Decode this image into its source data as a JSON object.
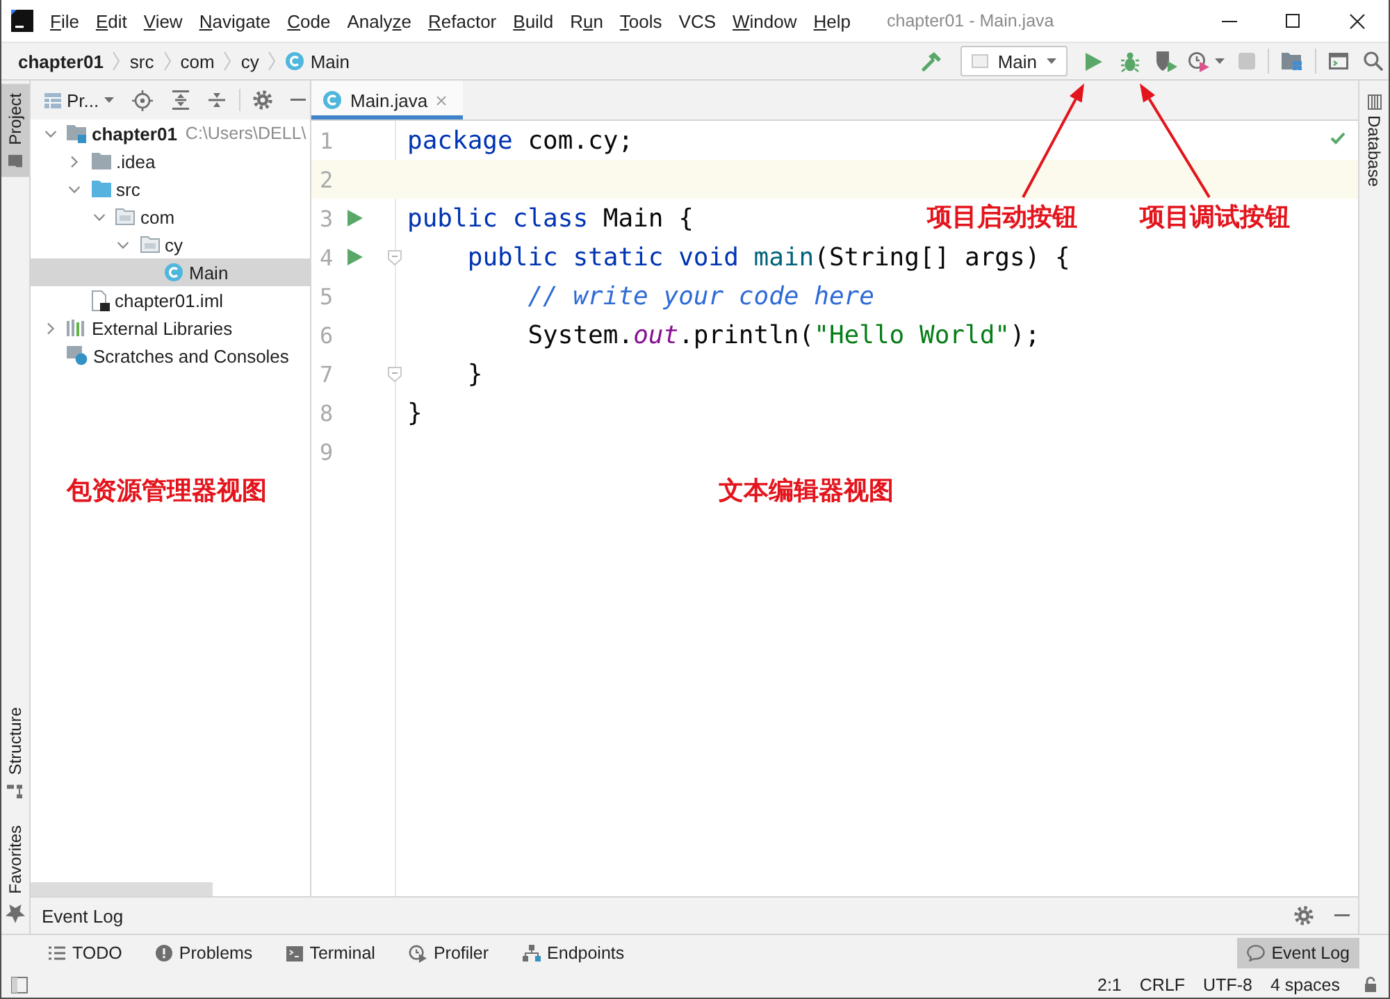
{
  "window": {
    "title": "chapter01 - Main.java"
  },
  "menu": [
    {
      "key": "F",
      "post": "ile"
    },
    {
      "key": "E",
      "post": "dit"
    },
    {
      "key": "V",
      "post": "iew"
    },
    {
      "key": "N",
      "post": "avigate"
    },
    {
      "key": "C",
      "post": "ode"
    },
    {
      "pre": "Analy",
      "key": "z",
      "post": "e"
    },
    {
      "key": "R",
      "post": "efactor"
    },
    {
      "key": "B",
      "post": "uild"
    },
    {
      "pre": "R",
      "key": "u",
      "post": "n"
    },
    {
      "key": "T",
      "post": "ools"
    },
    {
      "pre": "VCS"
    },
    {
      "key": "W",
      "post": "indow"
    },
    {
      "key": "H",
      "post": "elp"
    }
  ],
  "breadcrumbs": [
    {
      "label": "chapter01",
      "kind": "project"
    },
    {
      "label": "src",
      "kind": "folder"
    },
    {
      "label": "com",
      "kind": "folder"
    },
    {
      "label": "cy",
      "kind": "folder"
    },
    {
      "label": "Main",
      "kind": "class"
    }
  ],
  "run_toolbar": {
    "run_config": "Main",
    "actions": [
      {
        "kind": "run",
        "disabled": false
      },
      {
        "kind": "debug",
        "disabled": false
      },
      {
        "kind": "coverage",
        "disabled": false
      },
      {
        "kind": "profile",
        "disabled": false
      },
      {
        "kind": "stop",
        "disabled": true
      }
    ]
  },
  "left_tool_tabs": [
    {
      "label": "Project",
      "kind": "project",
      "selected": true
    },
    {
      "label": "Structure",
      "kind": "structure",
      "selected": false
    },
    {
      "label": "Favorites",
      "kind": "favorites",
      "selected": false
    }
  ],
  "project_panel": {
    "view_selector": "Pr...",
    "tree": [
      {
        "label": "chapter01",
        "kind": "module",
        "path": "C:\\Users\\DELL\\",
        "expanded": true,
        "selected": false,
        "children": [
          {
            "label": ".idea",
            "kind": "folder",
            "expanded": false,
            "selected": false
          },
          {
            "label": "src",
            "kind": "source_folder",
            "expanded": true,
            "selected": false,
            "children": [
              {
                "label": "com",
                "kind": "package",
                "expanded": true,
                "selected": false,
                "children": [
                  {
                    "label": "cy",
                    "kind": "package",
                    "expanded": true,
                    "selected": false,
                    "children": [
                      {
                        "label": "Main",
                        "kind": "class",
                        "selected": true
                      }
                    ]
                  }
                ]
              }
            ]
          },
          {
            "label": "chapter01.iml",
            "kind": "module_file",
            "selected": false
          }
        ]
      },
      {
        "label": "External Libraries",
        "kind": "libraries",
        "expanded": false,
        "selected": false
      },
      {
        "label": "Scratches and Consoles",
        "kind": "scratches",
        "selected": false
      }
    ]
  },
  "editor_tabs": [
    {
      "label": "Main.java",
      "selected": true
    }
  ],
  "code": [
    {
      "number": "1",
      "run_marker": false,
      "fold_marker": false,
      "current": false,
      "tokens": [
        {
          "text": "package",
          "kind": "keyword"
        },
        {
          "text": " com.cy;",
          "kind": "plain"
        }
      ]
    },
    {
      "number": "2",
      "run_marker": false,
      "fold_marker": false,
      "current": true
    },
    {
      "number": "3",
      "run_marker": true,
      "fold_marker": false,
      "current": false,
      "tokens": [
        {
          "text": "public class",
          "kind": "keyword"
        },
        {
          "text": " Main {",
          "kind": "plain"
        }
      ]
    },
    {
      "number": "4",
      "run_marker": true,
      "fold_marker": true,
      "current": false,
      "tokens": [
        {
          "text": "    public static void",
          "kind": "keyword"
        },
        {
          "text": " main",
          "kind": "method"
        },
        {
          "text": "(String[] args) {",
          "kind": "plain"
        }
      ]
    },
    {
      "number": "5",
      "run_marker": false,
      "fold_marker": false,
      "current": false,
      "tokens": [
        {
          "text": "        // write your code here",
          "kind": "comment"
        }
      ]
    },
    {
      "number": "6",
      "run_marker": false,
      "fold_marker": false,
      "current": false,
      "tokens": [
        {
          "text": "        System.",
          "kind": "plain"
        },
        {
          "text": "out",
          "kind": "field"
        },
        {
          "text": ".println(",
          "kind": "plain"
        },
        {
          "text": "\"Hello World\"",
          "kind": "string"
        },
        {
          "text": ");",
          "kind": "plain"
        }
      ]
    },
    {
      "number": "7",
      "run_marker": false,
      "fold_marker": true,
      "current": false,
      "tokens": [
        {
          "text": "    }",
          "kind": "plain"
        }
      ]
    },
    {
      "number": "8",
      "run_marker": false,
      "fold_marker": false,
      "current": false,
      "tokens": [
        {
          "text": "}",
          "kind": "plain"
        }
      ]
    },
    {
      "number": "9",
      "run_marker": false,
      "fold_marker": false,
      "current": false
    }
  ],
  "right_tool_tabs": [
    {
      "label": "Database",
      "selected": false
    }
  ],
  "event_log_panel": {
    "title": "Event Log"
  },
  "bottom_tools_left": [
    {
      "label": "TODO",
      "kind": "todo",
      "selected": false
    },
    {
      "label": "Problems",
      "kind": "problems",
      "selected": false
    },
    {
      "label": "Terminal",
      "kind": "terminal",
      "selected": false
    },
    {
      "label": "Profiler",
      "kind": "profiler",
      "selected": false
    },
    {
      "label": "Endpoints",
      "kind": "endpoints",
      "selected": false
    }
  ],
  "bottom_tools_right": [
    {
      "label": "Event Log",
      "kind": "event_log",
      "selected": true
    }
  ],
  "status_bar": [
    "2:1",
    "CRLF",
    "UTF-8",
    "4 spaces"
  ],
  "annotations": [
    {
      "text": "项目启动按钮",
      "kind": "callout"
    },
    {
      "text": "项目调试按钮",
      "kind": "callout"
    },
    {
      "text": "包资源管理器视图",
      "kind": "label"
    },
    {
      "text": "文本编辑器视图",
      "kind": "label"
    }
  ]
}
